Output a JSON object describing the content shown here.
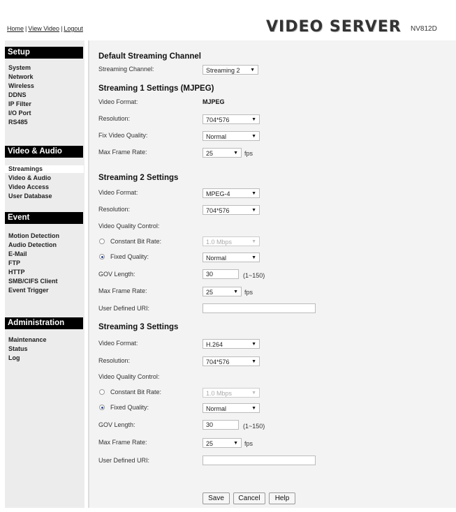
{
  "header": {
    "nav": [
      "Home",
      "View Video",
      "Logout"
    ],
    "brand": "VIDEO SERVER",
    "model": "NV812D"
  },
  "sidebar": {
    "setup": {
      "title": "Setup",
      "items": [
        "System",
        "Network",
        "Wireless",
        "DDNS",
        "IP Filter",
        "I/O Port",
        "RS485"
      ]
    },
    "video_audio": {
      "title": "Video & Audio",
      "items": [
        "Streamings",
        "Video & Audio",
        "Video Access",
        "User Database"
      ]
    },
    "event": {
      "title": "Event",
      "items": [
        "Motion Detection",
        "Audio Detection",
        "E-Mail",
        "FTP",
        "HTTP",
        "SMB/CIFS Client",
        "Event Trigger"
      ]
    },
    "administration": {
      "title": "Administration",
      "items": [
        "Maintenance",
        "Status",
        "Log"
      ]
    }
  },
  "main": {
    "default": {
      "heading": "Default Streaming Channel",
      "channel_label": "Streaming Channel:",
      "channel_value": "Streaming 2"
    },
    "s1": {
      "heading": "Streaming 1 Settings (MJPEG)",
      "format_label": "Video Format:",
      "format_value": "MJPEG",
      "resolution_label": "Resolution:",
      "resolution_value": "704*576",
      "quality_label": "Fix Video Quality:",
      "quality_value": "Normal",
      "framerate_label": "Max Frame Rate:",
      "framerate_value": "25",
      "fps": "fps"
    },
    "s2": {
      "heading": "Streaming 2 Settings",
      "format_label": "Video Format:",
      "format_value": "MPEG-4",
      "resolution_label": "Resolution:",
      "resolution_value": "704*576",
      "vqc_label": "Video Quality Control:",
      "cbr_label": "Constant Bit Rate:",
      "cbr_value": "1.0 Mbps",
      "fixed_label": "Fixed Quality:",
      "fixed_value": "Normal",
      "gov_label": "GOV Length:",
      "gov_value": "30",
      "gov_range": "(1~150)",
      "framerate_label": "Max Frame Rate:",
      "framerate_value": "25",
      "fps": "fps",
      "uri_label": "User Defined URI:",
      "uri_value": ""
    },
    "s3": {
      "heading": "Streaming 3 Settings",
      "format_label": "Video Format:",
      "format_value": "H.264",
      "resolution_label": "Resolution:",
      "resolution_value": "704*576",
      "vqc_label": "Video Quality Control:",
      "cbr_label": "Constant Bit Rate:",
      "cbr_value": "1.0 Mbps",
      "fixed_label": "Fixed Quality:",
      "fixed_value": "Normal",
      "gov_label": "GOV Length:",
      "gov_value": "30",
      "gov_range": "(1~150)",
      "framerate_label": "Max Frame Rate:",
      "framerate_value": "25",
      "fps": "fps",
      "uri_label": "User Defined URI:",
      "uri_value": ""
    },
    "buttons": {
      "save": "Save",
      "cancel": "Cancel",
      "help": "Help"
    }
  }
}
